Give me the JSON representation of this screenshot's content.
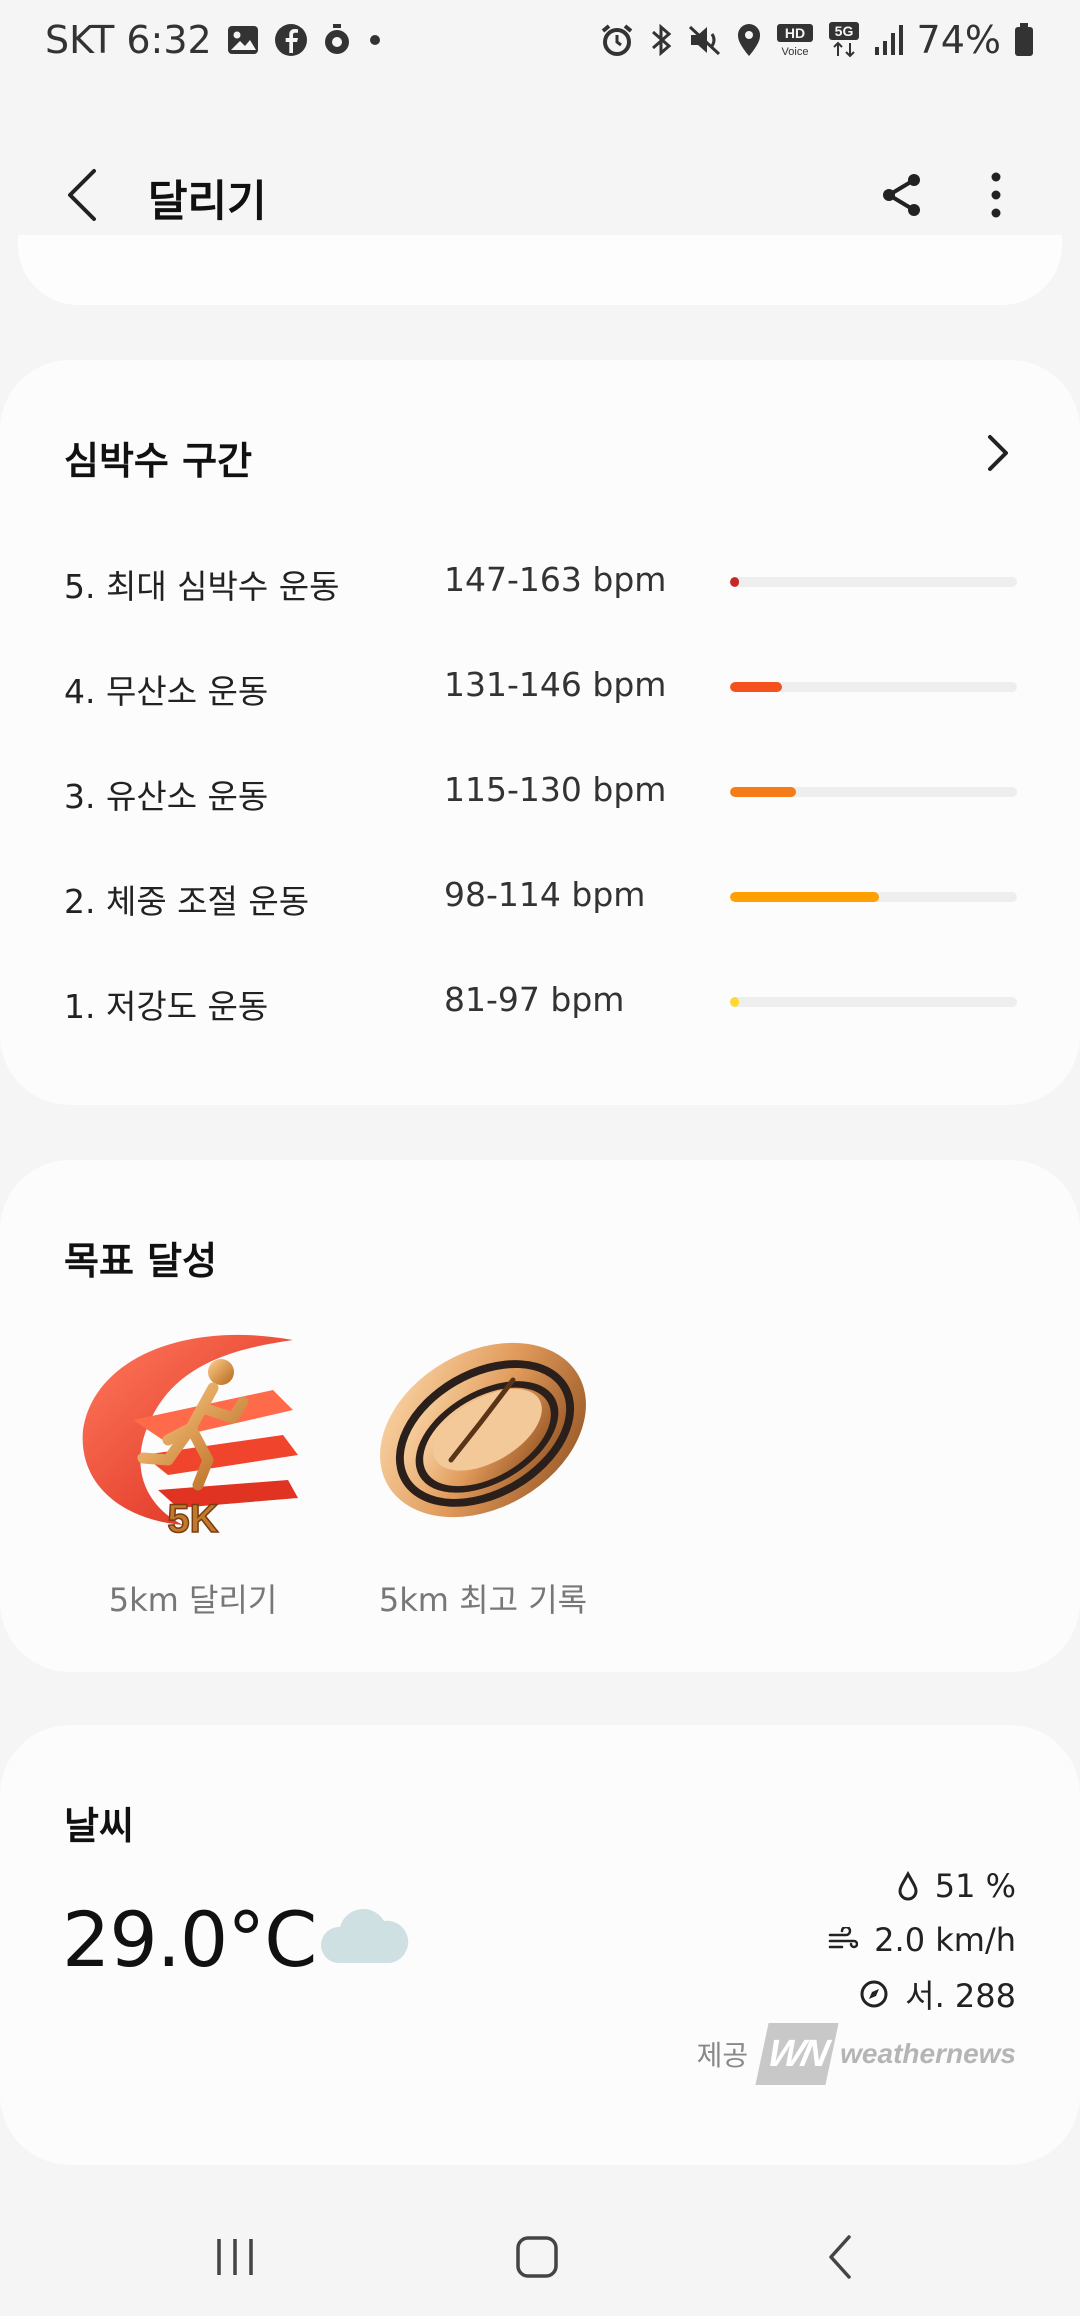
{
  "status_bar": {
    "time": "SKT 6:32",
    "battery": "74%"
  },
  "app_bar": {
    "title": "달리기"
  },
  "heart_rate": {
    "title": "심박수 구간",
    "zones": [
      {
        "label": "5. 최대 심박수 운동",
        "range": "147-163 bpm",
        "fraction": 0.03,
        "color": "#c62828"
      },
      {
        "label": "4. 무산소 운동",
        "range": "131-146 bpm",
        "fraction": 0.18,
        "color": "#f4511e"
      },
      {
        "label": "3. 유산소 운동",
        "range": "115-130 bpm",
        "fraction": 0.23,
        "color": "#f57c18"
      },
      {
        "label": "2. 체중 조절 운동",
        "range": "98-114 bpm",
        "fraction": 0.52,
        "color": "#ffa000"
      },
      {
        "label": "1. 저강도 운동",
        "range": "81-97 bpm",
        "fraction": 0.03,
        "color": "#fdd835"
      }
    ]
  },
  "goals": {
    "title": "목표 달성",
    "items": [
      {
        "label": "5km 달리기",
        "badge_text": "5K",
        "icon": "running-5k-badge-icon"
      },
      {
        "label": "5km 최고 기록",
        "icon": "stopwatch-ring-badge-icon"
      }
    ]
  },
  "weather": {
    "title": "날씨",
    "temperature": "29.0°C",
    "condition_icon": "cloud-icon",
    "humidity": "51 %",
    "wind_speed": "2.0 km/h",
    "wind_direction": "서. 288",
    "provider_label": "제공",
    "provider_logo_text": "WN",
    "provider_name": "weathernews"
  },
  "colors": {
    "track": "#eeeeee",
    "card": "#fcfcfc",
    "background": "#f5f5f5"
  }
}
